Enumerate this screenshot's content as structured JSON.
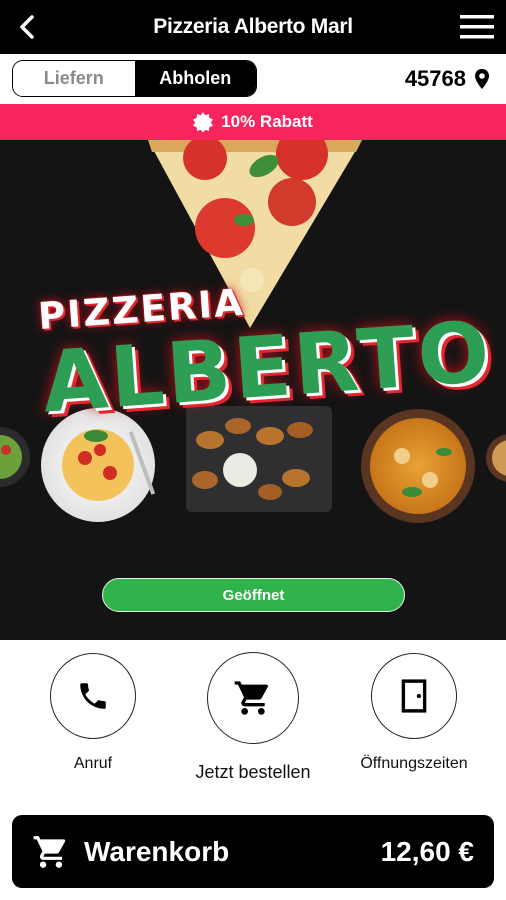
{
  "header": {
    "title": "Pizzeria Alberto Marl",
    "back_icon": "back-arrow-icon",
    "menu_icon": "hamburger-menu-icon"
  },
  "mode_toggle": {
    "options": [
      "Liefern",
      "Abholen"
    ],
    "selected": "Abholen"
  },
  "location": {
    "zip": "45768",
    "icon": "location-pin-icon"
  },
  "discount": {
    "label": "10% Rabatt",
    "icon": "badge-icon",
    "color": "#f7245d"
  },
  "hero": {
    "brand_line1": "PIZZERIA",
    "brand_line2": "ALBERTO",
    "status_button": "Geöffnet",
    "status_color": "#2fb34a"
  },
  "actions": [
    {
      "label": "Anruf",
      "icon": "phone-icon"
    },
    {
      "label": "Jetzt bestellen",
      "icon": "shopping-cart-icon"
    },
    {
      "label": "Öffnungszeiten",
      "icon": "door-icon"
    }
  ],
  "cart": {
    "label": "Warenkorb",
    "total": "12,60 €",
    "icon": "shopping-cart-icon"
  }
}
